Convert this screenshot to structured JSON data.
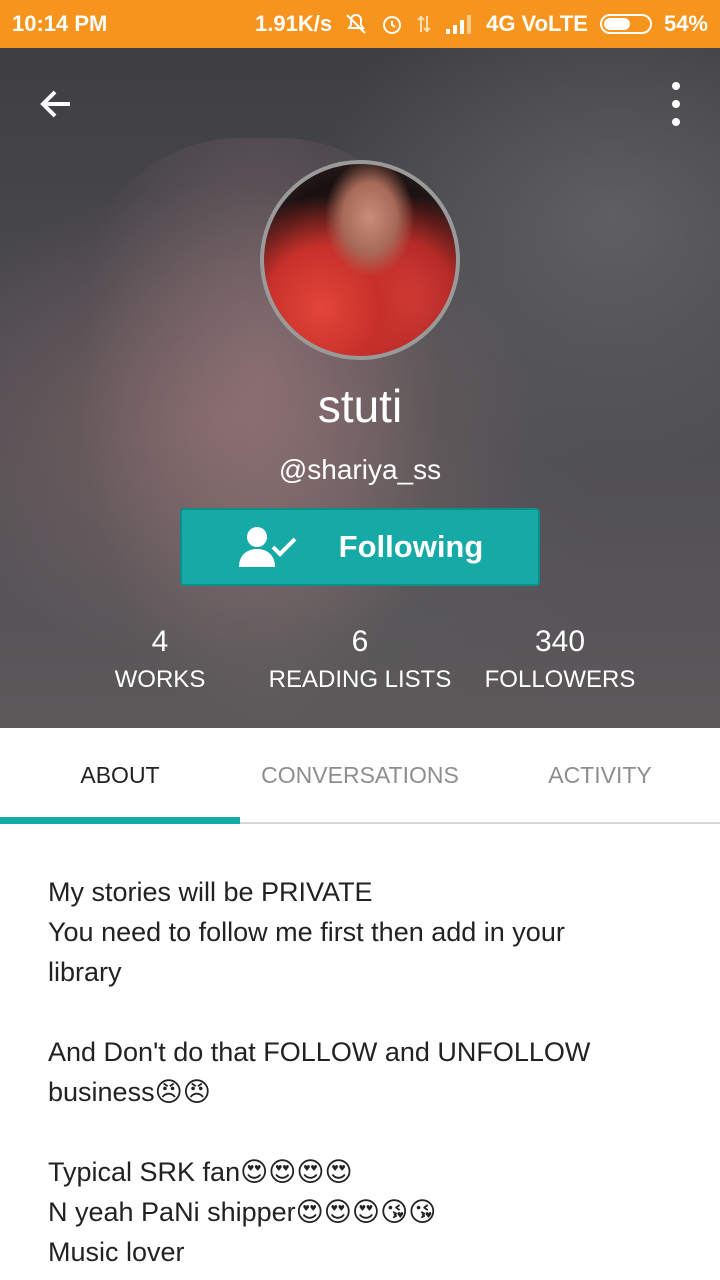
{
  "status_bar": {
    "time": "10:14 PM",
    "speed": "1.91K/s",
    "network": "4G VoLTE",
    "battery": "54%",
    "background_color": "#f7941d"
  },
  "profile": {
    "display_name": "stuti",
    "username": "@shariya_ss",
    "follow_button_label": "Following",
    "accent_color": "#16aaa7"
  },
  "stats": [
    {
      "value": "4",
      "label": "WORKS"
    },
    {
      "value": "6",
      "label": "READING LISTS"
    },
    {
      "value": "340",
      "label": "FOLLOWERS"
    }
  ],
  "tabs": [
    {
      "label": "ABOUT",
      "active": true
    },
    {
      "label": "CONVERSATIONS",
      "active": false
    },
    {
      "label": "ACTIVITY",
      "active": false
    }
  ],
  "about": {
    "lines": [
      "My stories will be PRIVATE",
      "You need to follow me first then add in your",
      "library",
      "",
      "And Don't do that FOLLOW and UNFOLLOW",
      "business😠😠",
      "",
      "Typical SRK fan😍😍😍😍",
      "N yeah PaNi shipper😍😍😍😘😘",
      "Music lover"
    ]
  },
  "icons": {
    "back": "arrow-left-icon",
    "more": "more-vertical-icon",
    "follow": "user-check-icon",
    "mute": "bell-off-icon",
    "alarm": "alarm-icon",
    "data": "data-arrows-icon",
    "signal": "signal-icon",
    "battery": "battery-icon"
  }
}
